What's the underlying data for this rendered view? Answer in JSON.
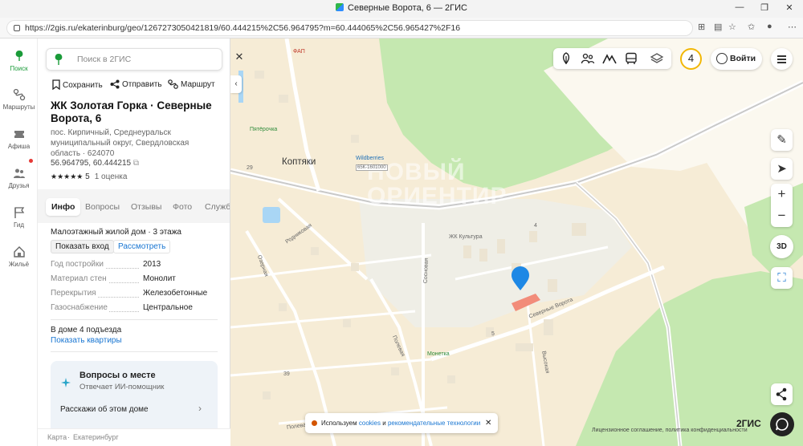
{
  "browser": {
    "title": "Северные Ворота, 6 — 2ГИС",
    "url": "https://2gis.ru/ekaterinburg/geo/1267273050421819/60.444215%2C56.964795?m=60.444065%2C56.965427%2F16"
  },
  "rail": {
    "items": [
      {
        "label": "Поиск",
        "icon": "search-leaf-icon"
      },
      {
        "label": "Маршруты",
        "icon": "route-icon"
      },
      {
        "label": "Афиша",
        "icon": "ticket-icon"
      },
      {
        "label": "Друзья",
        "icon": "friends-icon"
      },
      {
        "label": "Гид",
        "icon": "flag-icon"
      },
      {
        "label": "Жильё",
        "icon": "house-icon"
      }
    ]
  },
  "panel": {
    "search_placeholder": "Поиск в 2ГИС",
    "actions": {
      "save": "Сохранить",
      "send": "Отправить",
      "route": "Маршрут"
    },
    "title": "ЖК Золотая Горка · Северные Ворота, 6",
    "address": "пос. Кирпичный, Среднеуральск муниципальный округ, Свердловская область · 624070",
    "coords": "56.964795, 60.444215",
    "rating": {
      "stars": "★★★★★",
      "value": "5",
      "count": "1 оценка"
    },
    "tabs": [
      "Инфо",
      "Вопросы",
      "Отзывы",
      "Фото",
      "Служб"
    ],
    "info": {
      "desc": "Малоэтажный жилой дом · 3 этажа",
      "btn_entrance": "Показать вход",
      "btn_view": "Рассмотреть",
      "props": [
        {
          "k": "Год постройки",
          "v": "2013"
        },
        {
          "k": "Материал стен",
          "v": "Монолит"
        },
        {
          "k": "Перекрытия",
          "v": "Железобетонные"
        },
        {
          "k": "Газоснабжение",
          "v": "Центральное"
        }
      ],
      "entrances": "В доме 4 подъезда",
      "show_flats": "Показать квартиры"
    },
    "ai_card": {
      "title": "Вопросы о месте",
      "subtitle": "Отвечает ИИ-помощник",
      "prompt": "Расскажи об этом доме"
    },
    "footer": {
      "map": "Карта",
      "city": "Екатеринбург"
    }
  },
  "map": {
    "labels": {
      "village": "Коптяки",
      "pharmacy": "ФАП",
      "shop": "Пятёрочка",
      "wildberries": "Wildberries",
      "wb_code": "65К-1601000",
      "culture": "ЖК Культура",
      "street_north": "Северные Ворота",
      "street_sosnovaya": "Сосновая",
      "street_polevaya": "Полевая",
      "street_rodnikovaya": "Родниковая",
      "street_ozernaya": "Озерная",
      "street_vysokaya": "Высокая",
      "monetka": "Монетка",
      "polevaya2": "Полевая",
      "n29": "29",
      "n39": "39",
      "n4": "4",
      "n5": "5",
      "watermark1": "НОВЫЙ",
      "watermark2": "ОРИЕНТИР"
    },
    "login": "Войти",
    "notif_count": "4",
    "btn3d": "3D",
    "brand": "2ГИС",
    "license": "Лицензионное соглашение, политика конфиденциальности",
    "cookie": {
      "text1": "Используем",
      "link1": "cookies",
      "and": "и",
      "link2": "рекомендательные технологии"
    }
  }
}
